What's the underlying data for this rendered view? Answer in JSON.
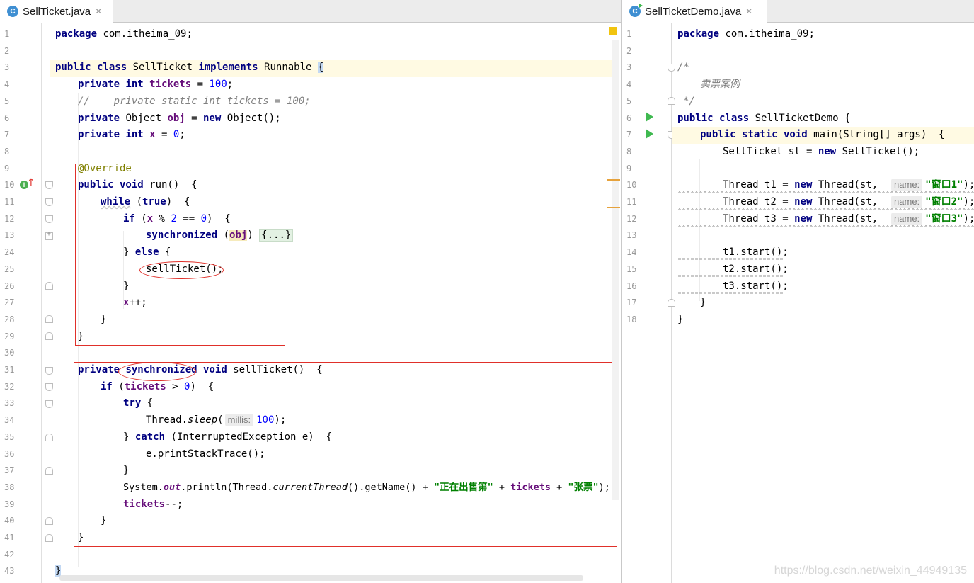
{
  "left_pane": {
    "tab": {
      "icon": "class-c-icon",
      "icon_letter": "C",
      "label": "SellTicket.java",
      "close": "✕"
    },
    "line_numbers": [
      "1",
      "2",
      "3",
      "4",
      "5",
      "6",
      "7",
      "8",
      "9",
      "10",
      "11",
      "12",
      "13",
      "24",
      "25",
      "26",
      "27",
      "28",
      "29",
      "30",
      "31",
      "32",
      "33",
      "34",
      "35",
      "36",
      "37",
      "38",
      "39",
      "40",
      "41",
      "42",
      "43"
    ]
  },
  "right_pane": {
    "tab": {
      "icon": "class-c-run-icon",
      "icon_letter": "C",
      "label": "SellTicketDemo.java",
      "close": "✕"
    },
    "line_numbers": [
      "1",
      "2",
      "3",
      "4",
      "5",
      "6",
      "7",
      "8",
      "9",
      "10",
      "11",
      "12",
      "13",
      "14",
      "15",
      "16",
      "17",
      "18"
    ]
  },
  "code_left": {
    "l1": {
      "kw": "package",
      "rest": " com.itheima_09;"
    },
    "l3": {
      "kw1": "public class",
      "name": " SellTicket ",
      "kw2": "implements",
      "iface": " Runnable ",
      "brace": "{"
    },
    "l4": {
      "kw": "private int",
      "field": "tickets",
      "eq": " = ",
      "num": "100",
      "semi": ";"
    },
    "l5": {
      "comment": "//    private static int tickets = 100;"
    },
    "l6": {
      "kw": "private",
      "type": " Object ",
      "field": "obj",
      "eq": " = ",
      "kw2": "new",
      "rest": " Object();"
    },
    "l7": {
      "kw": "private int",
      "field": "x",
      "eq": " = ",
      "num": "0",
      "semi": ";"
    },
    "l9": {
      "annotation": "@Override"
    },
    "l10": {
      "kw": "public void",
      "rest": " run()  {"
    },
    "l11": {
      "kw": "while",
      "p1": " (",
      "kw2": "true",
      "p2": ")  {"
    },
    "l12": {
      "kw": "if",
      "p1": " (",
      "field": "x",
      "op": " % ",
      "num1": "2",
      "eq": " == ",
      "num2": "0",
      "p2": ")  {"
    },
    "l13": {
      "kw": "synchronized",
      "p1": " (",
      "field": "obj",
      "p2": ") ",
      "fold": "{...}"
    },
    "l24": {
      "brace": "}",
      "kw": " else",
      "rest": " {"
    },
    "l25": {
      "call": "sellTicket();"
    },
    "l26": {
      "brace": "}"
    },
    "l27": {
      "field": "x",
      "rest": "++;"
    },
    "l28": {
      "brace": "}"
    },
    "l29": {
      "brace": "}"
    },
    "l31": {
      "kw1": "private",
      "kw2": "synchronized",
      "kw3": "void",
      "rest": " sellTicket()  {"
    },
    "l32": {
      "kw": "if",
      "p1": " (",
      "field": "tickets",
      "op": " > ",
      "num": "0",
      "p2": ")  {"
    },
    "l33": {
      "kw": "try",
      "rest": " {"
    },
    "l34": {
      "cls": "Thread.",
      "method": "sleep",
      "p1": "(",
      "hint": "millis:",
      "num": "100",
      "p2": ");"
    },
    "l35": {
      "brace": "} ",
      "kw": "catch",
      "rest": " (InterruptedException e)  {"
    },
    "l36": {
      "rest": "e.printStackTrace();"
    },
    "l37": {
      "brace": "}"
    },
    "l38": {
      "cls": "System.",
      "out": "out",
      "p1": ".println(Thread.",
      "method": "currentThread",
      "p2": "().getName() + ",
      "str1": "\"正在出售第\"",
      "plus1": " + ",
      "field": "tickets",
      "plus2": " + ",
      "str2": "\"张票\"",
      "end": ");"
    },
    "l39": {
      "field": "tickets",
      "rest": "--;"
    },
    "l40": {
      "brace": "}"
    },
    "l41": {
      "brace": "}"
    },
    "l43": {
      "brace": "}"
    }
  },
  "code_right": {
    "l1": {
      "kw": "package",
      "rest": " com.itheima_09;"
    },
    "l3": {
      "comment": "/*"
    },
    "l4": {
      "comment": "卖票案例"
    },
    "l5": {
      "comment": "*/"
    },
    "l6": {
      "kw": "public class",
      "rest": " SellTicketDemo {"
    },
    "l7": {
      "kw": "public static void",
      "rest": " main(String[] args)  {"
    },
    "l8": {
      "p1": "SellTicket st = ",
      "kw": "new",
      "p2": " SellTicket();"
    },
    "l10": {
      "p1": "Thread t1 = ",
      "kw": "new",
      "p2": " Thread(st,  ",
      "hint": "name:",
      "str": "\"窗口1\"",
      "end": ");"
    },
    "l11": {
      "p1": "Thread t2 = ",
      "kw": "new",
      "p2": " Thread(st,  ",
      "hint": "name:",
      "str": "\"窗口2\"",
      "end": ");"
    },
    "l12": {
      "p1": "Thread t3 = ",
      "kw": "new",
      "p2": " Thread(st,  ",
      "hint": "name:",
      "str": "\"窗口3\"",
      "end": ");"
    },
    "l14": {
      "rest": "t1.start();"
    },
    "l15": {
      "rest": "t2.start();"
    },
    "l16": {
      "rest": "t3.start();"
    },
    "l17": {
      "brace": "}"
    },
    "l18": {
      "brace": "}"
    }
  },
  "gutter_icons": {
    "implements": "implements-method-icon",
    "implements_letter": "I",
    "override_arrow": "↑",
    "run": "run-gutter-icon"
  },
  "watermark": "https://blog.csdn.net/weixin_44949135",
  "colors": {
    "keyword": "#000080",
    "field": "#660e7a",
    "number": "#0000ff",
    "string": "#008000",
    "comment": "#808080",
    "annotation": "#808000",
    "red_box": "#e0302a",
    "current_line": "#fffae3"
  }
}
